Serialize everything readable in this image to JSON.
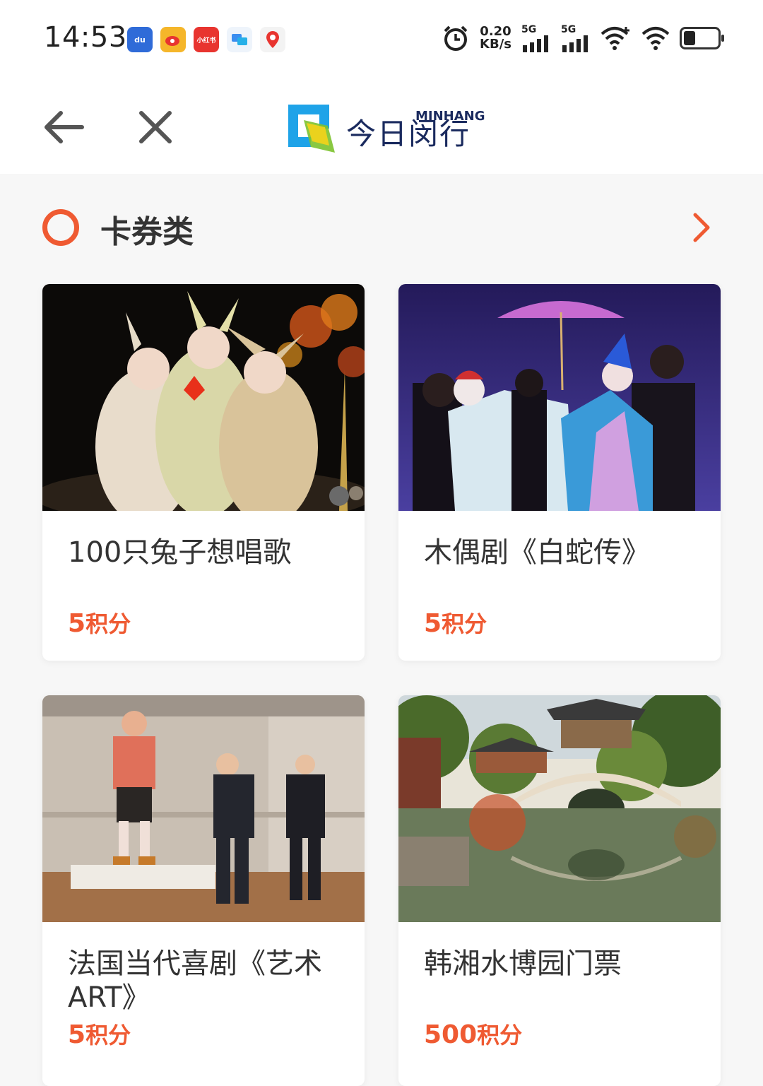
{
  "status_bar": {
    "time": "14:53",
    "apps": [
      {
        "icon": "baidu-icon",
        "label": "du",
        "color": "#2f6bd8"
      },
      {
        "icon": "weibo-icon",
        "label": "微",
        "color": "#f0a020"
      },
      {
        "icon": "xiaohongshu-icon",
        "label": "小红书",
        "color": "#e8342f"
      },
      {
        "icon": "message-icon",
        "label": "",
        "color": "#3a8ef0"
      },
      {
        "icon": "map-pin-icon",
        "label": "du",
        "color": "#e8342f"
      }
    ],
    "speed_value": "0.20",
    "speed_unit": "KB/s",
    "network_1": "5G",
    "network_2": "5G",
    "battery_level": 0.35
  },
  "header": {
    "back_icon": "arrow-left-icon",
    "close_icon": "close-icon",
    "logo_cn": "今日闵行",
    "logo_en": "MINHANG"
  },
  "section": {
    "title": "卡券类",
    "more_icon": "chevron-right-icon",
    "accent_color": "#ef5a32"
  },
  "cards": [
    {
      "title": "100只兔子想唱歌",
      "points": "5",
      "unit": "积分"
    },
    {
      "title": "木偶剧《白蛇传》",
      "points": "5",
      "unit": "积分"
    },
    {
      "title": "法国当代喜剧《艺术ART》",
      "points": "5",
      "unit": "积分"
    },
    {
      "title": "韩湘水博园门票",
      "points": "500",
      "unit": "积分"
    }
  ]
}
